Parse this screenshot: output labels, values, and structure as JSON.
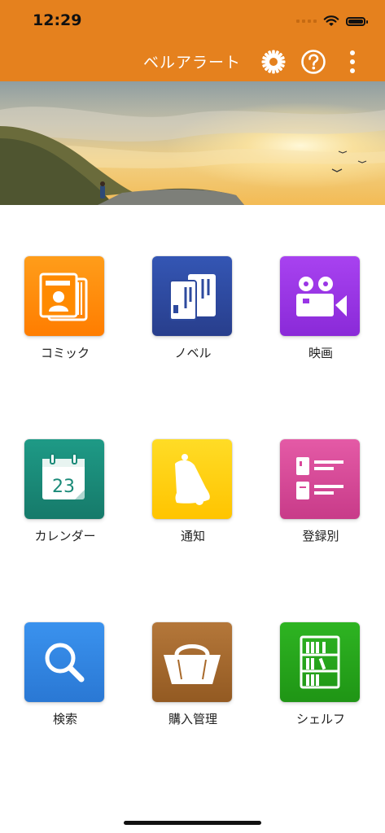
{
  "status_bar": {
    "time": "12:29"
  },
  "header": {
    "title": "ベルアラート"
  },
  "icons": {
    "settings": "gear-icon",
    "help": "question-icon",
    "menu": "more-vertical-icon"
  },
  "banner": {
    "description_icon": "landscape-banner-image"
  },
  "menu": {
    "items": [
      {
        "label": "コミック",
        "icon": "comic-icon",
        "color": "#ff8a00"
      },
      {
        "label": "ノベル",
        "icon": "novel-icon",
        "color": "#2f4fa6"
      },
      {
        "label": "映画",
        "icon": "movie-camera-icon",
        "color": "#9a35e6"
      },
      {
        "label": "カレンダー",
        "icon": "calendar-icon",
        "color": "#1a8a78",
        "calendar_day": "23"
      },
      {
        "label": "通知",
        "icon": "bell-icon",
        "color": "#ffd200"
      },
      {
        "label": "登録別",
        "icon": "registration-list-icon",
        "color": "#d9489a"
      },
      {
        "label": "検索",
        "icon": "search-icon",
        "color": "#2f86e6"
      },
      {
        "label": "購入管理",
        "icon": "shopping-basket-icon",
        "color": "#a8692a"
      },
      {
        "label": "シェルフ",
        "icon": "bookshelf-icon",
        "color": "#27a51b"
      }
    ]
  }
}
